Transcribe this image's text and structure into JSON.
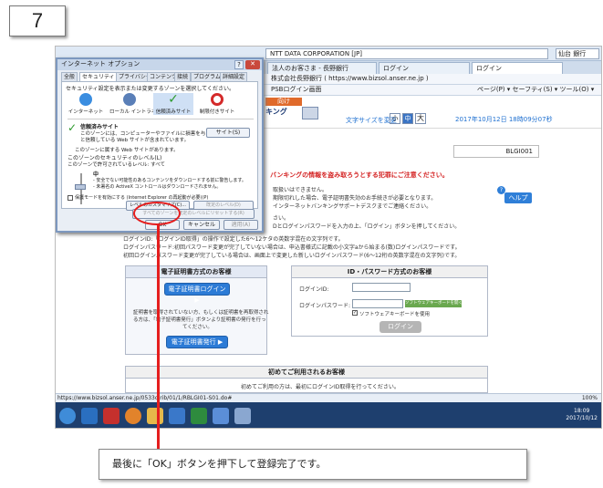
{
  "step": "7",
  "browser": {
    "address": "https://www.bizsol.anser.ne.jp/",
    "search_provider": "NTT DATA CORPORATION [JP]",
    "search_text": "仙台 銀行",
    "tabs": [
      "法人のお客さま - 長野銀行",
      "ログイン",
      "ログイン"
    ],
    "favorites": "株式会社長野銀行 ( https://www.bizsol.anser.ne.jp )",
    "pagetab": "PSBログイン画面",
    "commands": "ページ(P) ▾  セーフティ(S) ▾  ツール(O) ▾",
    "status_url": "https://www.bizsol.anser.ne.jp/0533c/rib/01/1/RBLGI01-S01.do#",
    "zoom": "100%",
    "clock_time": "18:09",
    "clock_date": "2017/10/12"
  },
  "page": {
    "nav": "向け",
    "brand": "キング",
    "fontsize_label": "文字サイズを変更",
    "fontsize_buttons": [
      "小",
      "中",
      "大"
    ],
    "datetime": "2017年10月12日 18時09分07秒",
    "code": "BLGI001",
    "warning": "バンキングの情報を盗み取ろうとする犯罪にご注意ください。",
    "lines": [
      "取扱いはできません。",
      "期限切れした場合、電子証明書失効のお手続きが必要となります。",
      "インターネットバンキングサポートデスクまでご連絡ください。",
      "さい。",
      "Dとログインパスワードを入力の上、「ログイン」ボタンを押してください。",
      "ログインID:「ログインID取得」の操作で設定した6～12ケタの英数字混在の文字列です。",
      "ログインパスワード:初回パスワード変更が完了していない場合は、申込書様式に記載の小文字aから始まる(数)ログインパスワードです。",
      "初回ログインパスワード変更が完了している場合は、画面上で変更した新しいログインパスワード(6～12桁の英数字混在の文字列)です。"
    ],
    "help": "ヘルプ",
    "cert_panel_title": "電子証明書方式のお客様",
    "cert_login": "電子証明書ログイン ▶",
    "cert_note_1": "証明書を取得されていない方、もしくは証明書を再取得され",
    "cert_note_2": "る方は、「電子証明書発行」ボタンより証明書の発行を行っ",
    "cert_note_3": "てください。",
    "cert_issue": "電子証明書発行 ▶",
    "id_panel_title": "ID・パスワード方式のお客様",
    "login_id_label": "ログインID:",
    "login_pw_label": "ログインパスワード:",
    "soft_keyboard_btn": "ソフトウェアキーボードを開く",
    "soft_keyboard_chk": "ソフトウェアキーボードを使用",
    "login_button": "ログイン",
    "first_title": "初めてご利用されるお客様",
    "first_text": "初めてご利用の方は、最初にログインID取得を行ってください。"
  },
  "dialog": {
    "title": "インターネット オプション",
    "close": "✕",
    "help": "?",
    "tabs": [
      "全般",
      "セキュリティ",
      "プライバシー",
      "コンテンツ",
      "接続",
      "プログラム",
      "詳細設定"
    ],
    "intro": "セキュリティ設定を表示または変更するゾーンを選択してください。",
    "zones": [
      "インターネット",
      "ローカル イントラネット",
      "信頼済みサイト",
      "制限付きサイト"
    ],
    "zone_title": "信頼済みサイト",
    "zone_desc_1": "このゾーンには、コンピューターやファイルに損害を与えない",
    "zone_desc_2": "と信頼している Web サイトが含まれています。",
    "sites_button": "サイト(S)",
    "zone_has_sites": "このゾーンに属する Web サイトがあります。",
    "level_title": "このゾーンのセキュリティのレベル(L)",
    "level_allowed": "このゾーンで許可されているレベル: すべて",
    "level_name": "中",
    "level_desc_1": "- 安全でない可能性のあるコンテンツをダウンロードする前に警告します。",
    "level_desc_2": "- 未署名の ActiveX コントロールはダウンロードされません。",
    "protected_mode": "保護モードを有効にする (Internet Explorer の再起動が必要)(P)",
    "custom_level": "レベルのカスタマイズ(C)...",
    "default_level": "既定のレベル(D)",
    "reset_all": "すべてのゾーンを既定のレベルにリセットする(R)",
    "ok": "OK",
    "cancel": "キャンセル",
    "apply": "適用(A)"
  },
  "caption": "最後に「OK」ボタンを押下して登録完了です。"
}
